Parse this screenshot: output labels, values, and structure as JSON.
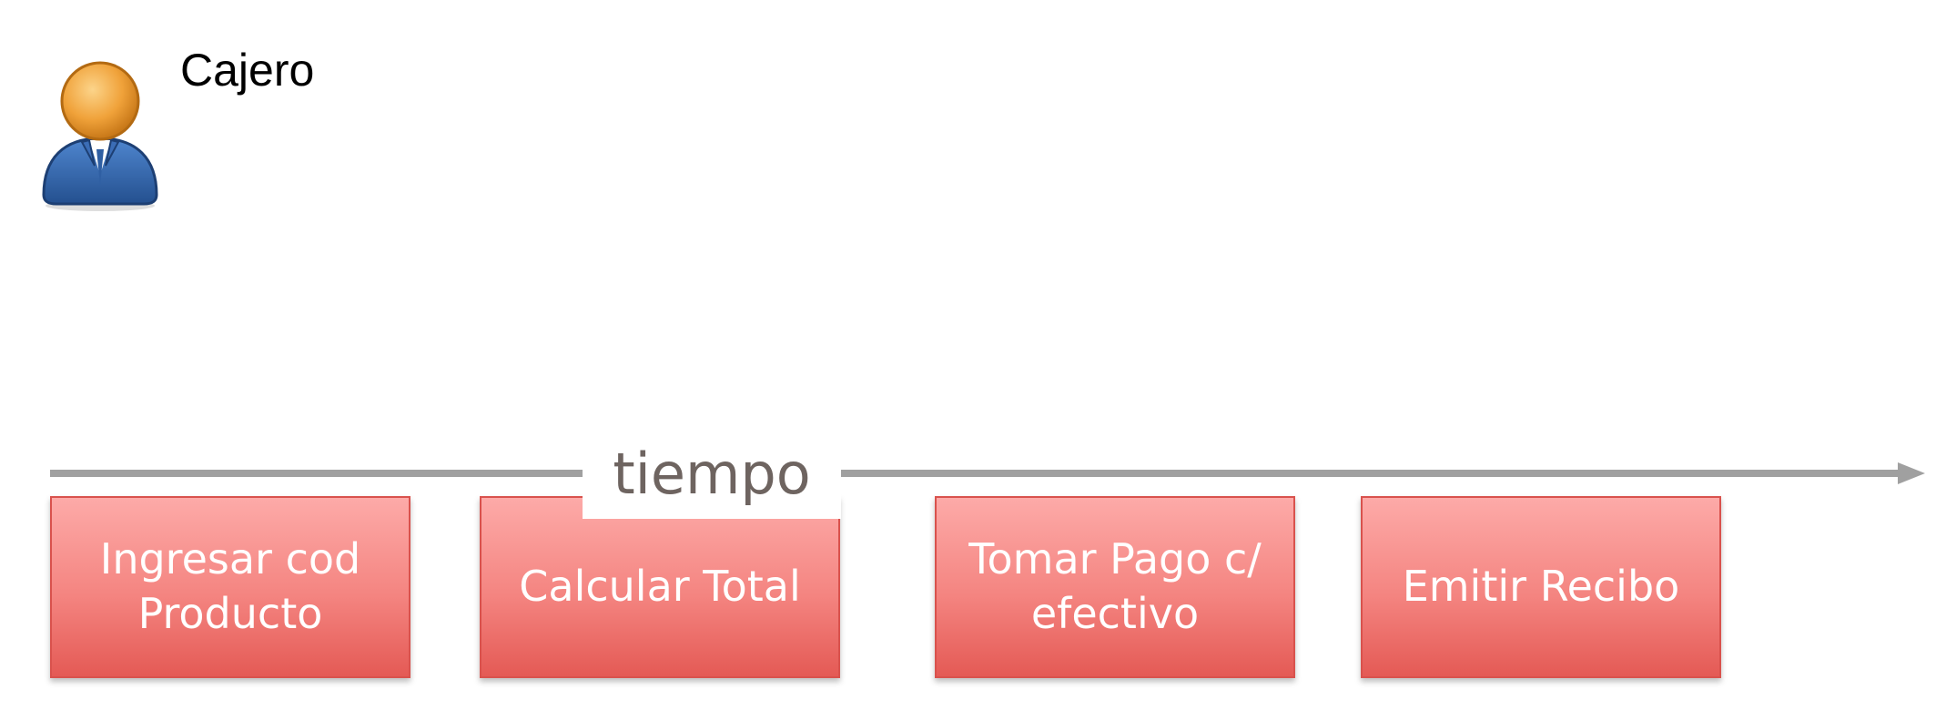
{
  "actor": {
    "name": "Cajero",
    "icon": "person-icon"
  },
  "timeline": {
    "label": "tiempo",
    "line_color": "#a0a0a0"
  },
  "steps": [
    {
      "line1": "Ingresar cod",
      "line2": "Producto"
    },
    {
      "line1": "Calcular Total",
      "line2": ""
    },
    {
      "line1": "Tomar Pago c/",
      "line2": "efectivo"
    },
    {
      "line1": "Emitir Recibo",
      "line2": ""
    }
  ],
  "colors": {
    "step_top": "#fdaaa8",
    "step_bottom": "#e45a55",
    "step_text": "#ffffff",
    "actor_head": "#f0a23a",
    "actor_body": "#2f5fa3"
  }
}
